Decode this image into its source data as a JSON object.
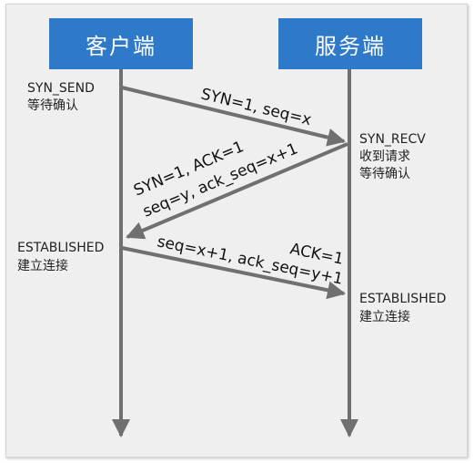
{
  "client": {
    "title": "客户端"
  },
  "server": {
    "title": "服务端"
  },
  "states": {
    "client_syn_send": "SYN_SEND",
    "client_wait_confirm": "等待确认",
    "server_syn_recv": "SYN_RECV",
    "server_received": "收到请求",
    "server_wait_confirm": "等待确认",
    "client_established": "ESTABLISHED",
    "client_connected": "建立连接",
    "server_established": "ESTABLISHED",
    "server_connected": "建立连接"
  },
  "messages": {
    "msg1": "SYN=1, seq=x",
    "msg2_line1": "SYN=1, ACK=1",
    "msg2_line2": "seq=y, ack_seq=x+1",
    "msg3_ack": "ACK=1",
    "msg3_line": "seq=x+1, ack_seq=y+1"
  },
  "colors": {
    "header_bg": "#2f79c9",
    "arrow": "#707070",
    "panel_bg": "#efefef"
  }
}
